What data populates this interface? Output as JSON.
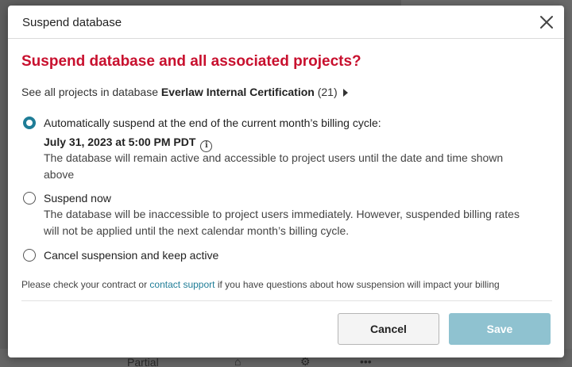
{
  "background": {
    "row_text": "Partial"
  },
  "dialog": {
    "title": "Suspend database",
    "heading": "Suspend database and all associated projects?",
    "db_line": {
      "prefix": "See all projects in database",
      "database_name": "Everlaw Internal Certification",
      "count": "(21)"
    },
    "options": [
      {
        "label": "Automatically suspend at the end of the current month’s billing cycle:",
        "date": "July 31, 2023 at 5:00 PM PDT",
        "description": "The database will remain active and accessible to project users until the date and time shown above",
        "selected": true
      },
      {
        "label": "Suspend now",
        "description": "The database will be inaccessible to project users immediately. However, suspended billing rates will not be applied until the next calendar month’s billing cycle.",
        "selected": false
      },
      {
        "label": "Cancel suspension and keep active",
        "selected": false
      }
    ],
    "footnote": {
      "before": "Please check your contract or ",
      "link": "contact support",
      "after": " if you have questions about how suspension will impact your billing"
    },
    "buttons": {
      "cancel": "Cancel",
      "save": "Save"
    }
  },
  "colors": {
    "heading": "#c8102e",
    "accent": "#1f7d97",
    "save_disabled": "#8fc2d0"
  }
}
